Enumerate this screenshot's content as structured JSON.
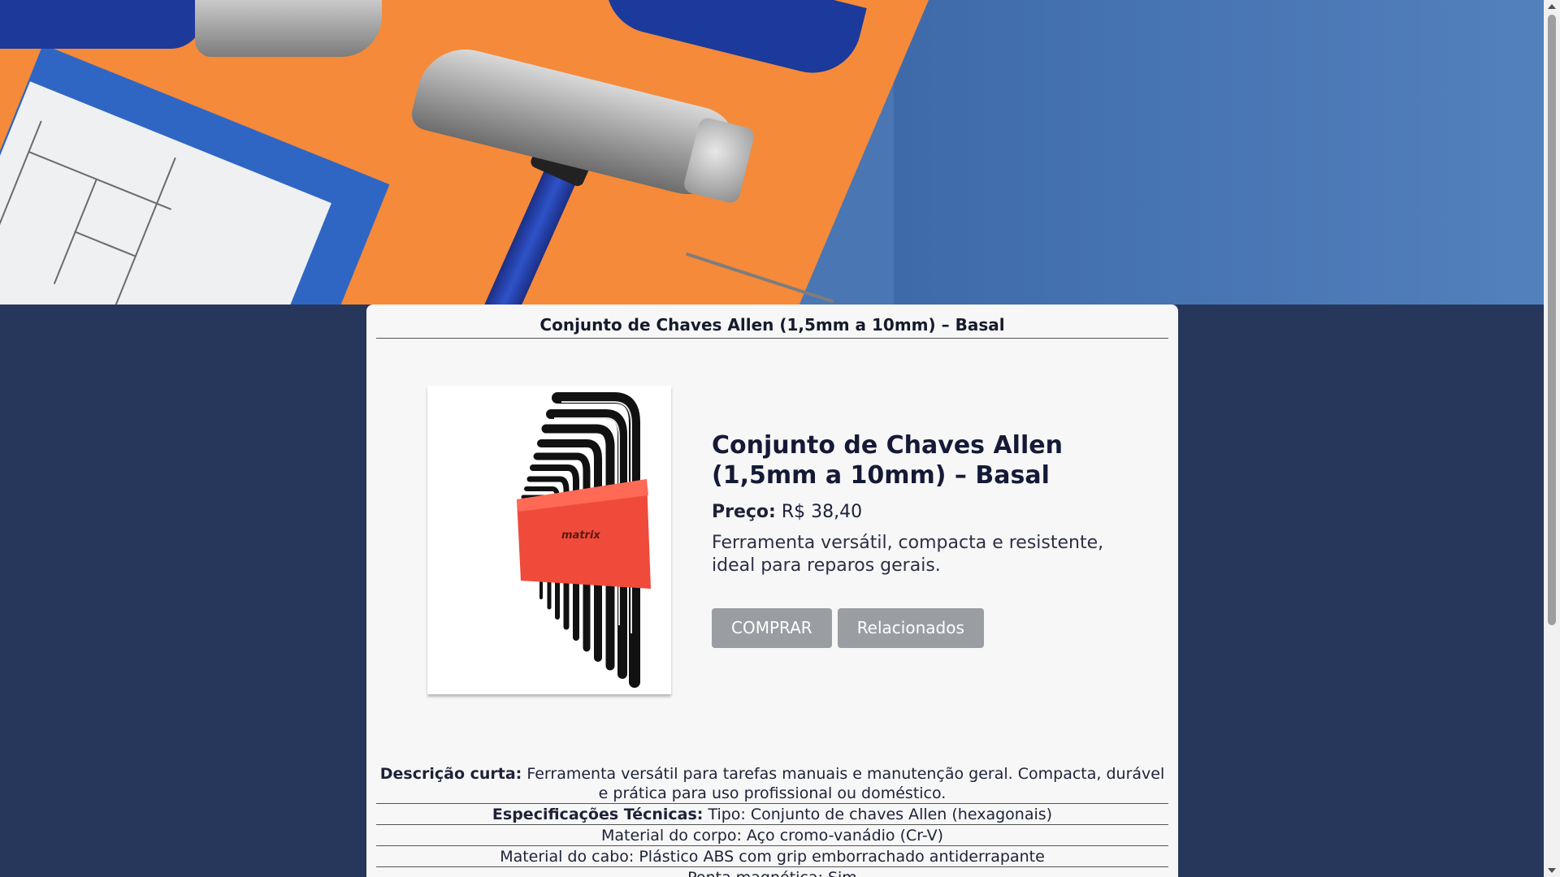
{
  "card": {
    "title": "Conjunto de Chaves Allen (1,5mm a 10mm) – Basal"
  },
  "product": {
    "name": "Conjunto de Chaves Allen (1,5mm a 10mm) – Basal",
    "price_label": "Preço:",
    "price_value": "R$ 38,40",
    "short_text": "Ferramenta versátil, compacta e resistente, ideal para reparos gerais.",
    "image_brand": "matrix"
  },
  "buttons": {
    "buy": "COMPRAR",
    "related": "Relacionados"
  },
  "details": {
    "desc_label": "Descrição curta:",
    "desc_text": "Ferramenta versátil para tarefas manuais e manutenção geral. Compacta, durável e prática para uso profissional ou doméstico.",
    "specs_label": "Especificações Técnicas:",
    "specs": [
      "Tipo: Conjunto de chaves Allen (hexagonais)",
      "Material do corpo: Aço cromo-vanádio (Cr-V)",
      "Material do cabo: Plástico ABS com grip emborrachado antiderrapante",
      "Ponta magnética: Sim"
    ]
  },
  "colors": {
    "page_background": "#27375c",
    "card_background": "#f7f7f7",
    "button_background": "#9a9ea3"
  }
}
